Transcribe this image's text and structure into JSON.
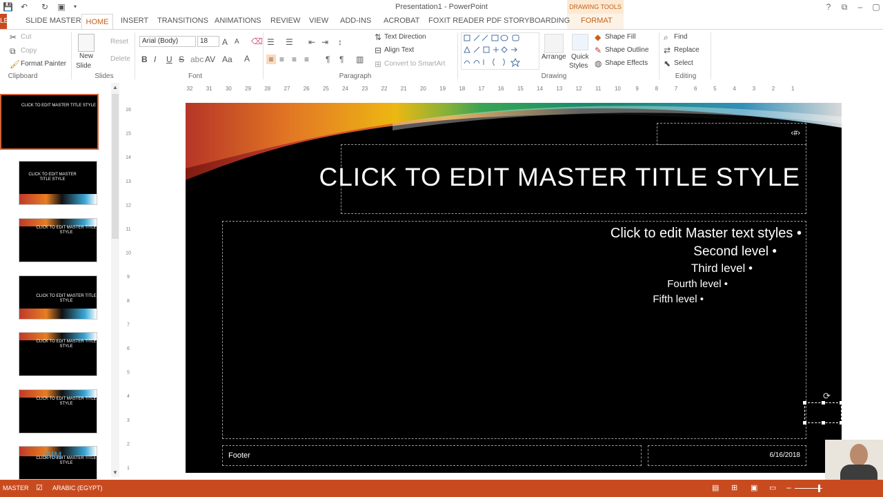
{
  "window": {
    "title": "Presentation1 - PowerPoint",
    "contextual_group": "DRAWING TOOLS"
  },
  "tabs": {
    "file": "LE",
    "slide_master": "SLIDE MASTER",
    "home": "HOME",
    "insert": "INSERT",
    "transitions": "TRANSITIONS",
    "animations": "ANIMATIONS",
    "review": "REVIEW",
    "view": "VIEW",
    "add_ins": "ADD-INS",
    "acrobat": "ACROBAT",
    "foxit": "FOXIT READER PDF",
    "storyboarding": "STORYBOARDING",
    "format": "FORMAT"
  },
  "ribbon": {
    "clipboard": {
      "label": "Clipboard",
      "cut": "Cut",
      "copy": "Copy",
      "format_painter": "Format Painter"
    },
    "slides": {
      "label": "Slides",
      "new_slide_1": "New",
      "new_slide_2": "Slide",
      "reset": "Reset",
      "delete": "Delete"
    },
    "font": {
      "label": "Font",
      "font_name": "Arial (Body)",
      "font_size": "18"
    },
    "paragraph": {
      "label": "Paragraph",
      "text_direction": "Text Direction",
      "align_text": "Align Text",
      "convert_smartart": "Convert to SmartArt"
    },
    "drawing": {
      "label": "Drawing",
      "arrange": "Arrange",
      "quick_styles_1": "Quick",
      "quick_styles_2": "Styles",
      "shape_fill": "Shape Fill",
      "shape_outline": "Shape Outline",
      "shape_effects": "Shape Effects"
    },
    "editing": {
      "label": "Editing",
      "find": "Find",
      "replace": "Replace",
      "select": "Select"
    }
  },
  "thumbnails": [
    {
      "title": "CLICK TO EDIT MASTER TITLE STYLE"
    },
    {
      "title": "CLICK TO EDIT MASTER TITLE STYLE"
    },
    {
      "title": "CLICK TO EDIT MASTER TITLE STYLE"
    },
    {
      "title": "CLICK TO EDIT MASTER TITLE STYLE"
    },
    {
      "title": "CLICK TO EDIT MASTER TITLE STYLE"
    },
    {
      "title": "CLICK TO EDIT MASTER TITLE STYLE"
    },
    {
      "title": "CLICK TO EDIT MASTER TITLE STYLE"
    }
  ],
  "ruler": {
    "horizontal": [
      "32",
      "31",
      "30",
      "29",
      "28",
      "27",
      "26",
      "25",
      "24",
      "23",
      "22",
      "21",
      "20",
      "19",
      "18",
      "17",
      "16",
      "15",
      "14",
      "13",
      "12",
      "11",
      "10",
      "9",
      "8",
      "7",
      "6",
      "5",
      "4",
      "3",
      "2",
      "1"
    ],
    "vertical": [
      "16",
      "15",
      "14",
      "13",
      "12",
      "11",
      "10",
      "9",
      "8",
      "7",
      "6",
      "5",
      "4",
      "3",
      "2",
      "1"
    ]
  },
  "slide": {
    "slide_number": "‹#›",
    "title": "CLICK TO EDIT MASTER TITLE STYLE",
    "levels": [
      "Click to edit Master text styles  •",
      "Second level  •",
      "Third level  •",
      "Fourth level  •",
      "Fifth level  •"
    ],
    "footer": "Footer",
    "date": "6/16/2018"
  },
  "status": {
    "view": "MASTER",
    "language": "ARABIC (EGYPT)"
  },
  "watermark": "BIM"
}
